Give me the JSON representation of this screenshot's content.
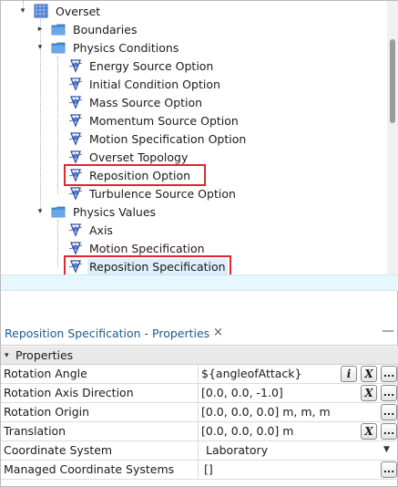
{
  "tree": {
    "items": [
      {
        "label": "Overset",
        "icon": "overset-region-icon"
      },
      {
        "label": "Boundaries",
        "icon": "folder-icon"
      },
      {
        "label": "Physics Conditions",
        "icon": "folder-icon"
      },
      {
        "label": "Energy Source Option",
        "icon": "physics-condition-icon"
      },
      {
        "label": "Initial Condition Option",
        "icon": "physics-condition-icon"
      },
      {
        "label": "Mass Source Option",
        "icon": "physics-condition-icon"
      },
      {
        "label": "Momentum Source Option",
        "icon": "physics-condition-icon"
      },
      {
        "label": "Motion Specification Option",
        "icon": "physics-condition-icon"
      },
      {
        "label": "Overset Topology",
        "icon": "physics-condition-icon"
      },
      {
        "label": "Reposition Option",
        "icon": "physics-condition-icon",
        "highlighted": true
      },
      {
        "label": "Turbulence Source Option",
        "icon": "physics-condition-icon"
      },
      {
        "label": "Physics Values",
        "icon": "folder-icon"
      },
      {
        "label": "Axis",
        "icon": "physics-value-icon"
      },
      {
        "label": "Motion Specification",
        "icon": "physics-value-icon"
      },
      {
        "label": "Reposition Specification",
        "icon": "physics-value-icon",
        "highlighted": true,
        "selected": true
      }
    ]
  },
  "properties": {
    "tab_title": "Reposition Specification - Properties",
    "tab_close": "×",
    "tab_minimize": "—",
    "section_label": "Properties",
    "rows": [
      {
        "name": "Rotation Angle",
        "value": "${angleofAttack}",
        "buttons": [
          "i",
          "X",
          "..."
        ]
      },
      {
        "name": "Rotation Axis Direction",
        "value": "[0.0, 0.0, -1.0]",
        "buttons": [
          "X",
          "..."
        ]
      },
      {
        "name": "Rotation Origin",
        "value": "[0.0, 0.0, 0.0] m, m, m",
        "buttons": [
          "..."
        ]
      },
      {
        "name": "Translation",
        "value": "[0.0, 0.0, 0.0] m",
        "buttons": [
          "X",
          "..."
        ]
      },
      {
        "name": "Coordinate System",
        "value": "Laboratory",
        "buttons": [
          "dropdown"
        ]
      },
      {
        "name": "Managed Coordinate Systems",
        "value": "[]",
        "buttons": [
          "..."
        ]
      }
    ]
  },
  "colors": {
    "highlight_box": "#e0262e",
    "folder": "#4a8fd6",
    "selection": "#dfeefa",
    "tab_text": "#1f5a8c",
    "status_band": "#e6f8fd"
  }
}
